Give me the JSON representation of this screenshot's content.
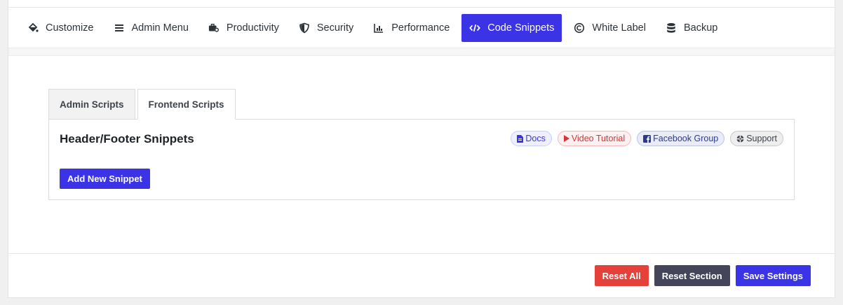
{
  "nav": {
    "items": [
      {
        "label": "Customize",
        "icon": "paint-bucket-icon"
      },
      {
        "label": "Admin Menu",
        "icon": "menu-bars-icon"
      },
      {
        "label": "Productivity",
        "icon": "briefcase-gear-icon"
      },
      {
        "label": "Security",
        "icon": "shield-icon"
      },
      {
        "label": "Performance",
        "icon": "bar-chart-icon"
      },
      {
        "label": "Code Snippets",
        "icon": "code-icon"
      },
      {
        "label": "White Label",
        "icon": "copyright-icon"
      },
      {
        "label": "Backup",
        "icon": "database-icon"
      }
    ],
    "active": "Code Snippets"
  },
  "tabs": [
    {
      "label": "Admin Scripts"
    },
    {
      "label": "Frontend Scripts"
    }
  ],
  "section": {
    "title": "Header/Footer Snippets",
    "add_button": "Add New Snippet",
    "links": {
      "docs": "Docs",
      "video": "Video Tutorial",
      "facebook": "Facebook Group",
      "support": "Support"
    }
  },
  "footer": {
    "reset_all": "Reset All",
    "reset_section": "Reset Section",
    "save": "Save Settings"
  },
  "colors": {
    "accent": "#3a34e6",
    "danger": "#e5413b",
    "dark": "#44455a"
  }
}
